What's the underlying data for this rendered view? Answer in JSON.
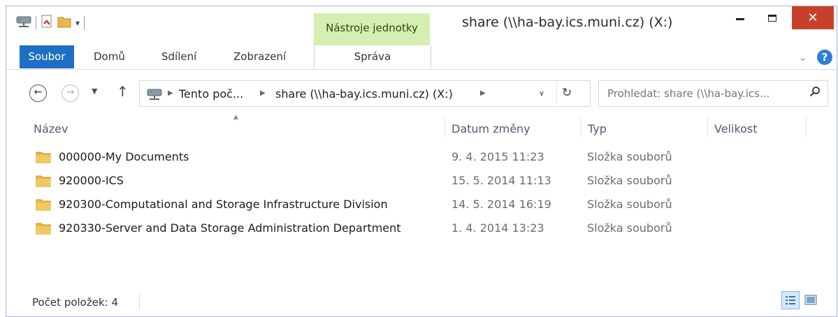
{
  "window": {
    "title": "share (\\\\ha-bay.ics.muni.cz) (X:)",
    "context_tool_label": "Nástroje jednotky",
    "close_glyph": "✕",
    "minimize_glyph": "—",
    "maximize_glyph": "☐"
  },
  "ribbon": {
    "tabs": {
      "file": "Soubor",
      "home": "Domů",
      "share": "Sdílení",
      "view": "Zobrazení",
      "manage": "Správa"
    },
    "collapse_glyph": "⌄",
    "help_glyph": "?"
  },
  "nav": {
    "back_glyph": "←",
    "forward_glyph": "→",
    "recent_glyph": "▼",
    "up_glyph": "↑",
    "breadcrumb": [
      "Tento poč...",
      "share (\\\\ha-bay.ics.muni.cz) (X:)"
    ],
    "crumb_sep": "▶",
    "dropdown_glyph": "∨",
    "refresh_glyph": "↻"
  },
  "search": {
    "placeholder": "Prohledat: share (\\\\ha-bay.ics...",
    "icon_glyph": "⚲"
  },
  "columns": {
    "name": "Název",
    "date": "Datum změny",
    "type": "Typ",
    "size": "Velikost",
    "sort_glyph": "▲"
  },
  "items": [
    {
      "name": "000000-My Documents",
      "date": "9. 4. 2015 11:23",
      "type": "Složka souborů"
    },
    {
      "name": "920000-ICS",
      "date": "15. 5. 2014 11:13",
      "type": "Složka souborů"
    },
    {
      "name": "920300-Computational and Storage Infrastructure Division",
      "date": "14. 5. 2014 16:19",
      "type": "Složka souborů"
    },
    {
      "name": "920330-Server and Data Storage Administration Department",
      "date": "1. 4. 2014 13:23",
      "type": "Složka souborů"
    }
  ],
  "status": {
    "count_text": "Počet položek: 4"
  },
  "icons": {
    "drive": "network-drive-icon",
    "properties": "properties-icon",
    "new_folder": "new-folder-icon",
    "folder": "folder-icon",
    "details_view": "details-view-icon",
    "large_icons_view": "large-icons-view-icon"
  },
  "colors": {
    "file_tab": "#1e6fc3",
    "context_tool": "#d5efb0",
    "close_button": "#c7402c",
    "folder": "#e8b84a"
  }
}
